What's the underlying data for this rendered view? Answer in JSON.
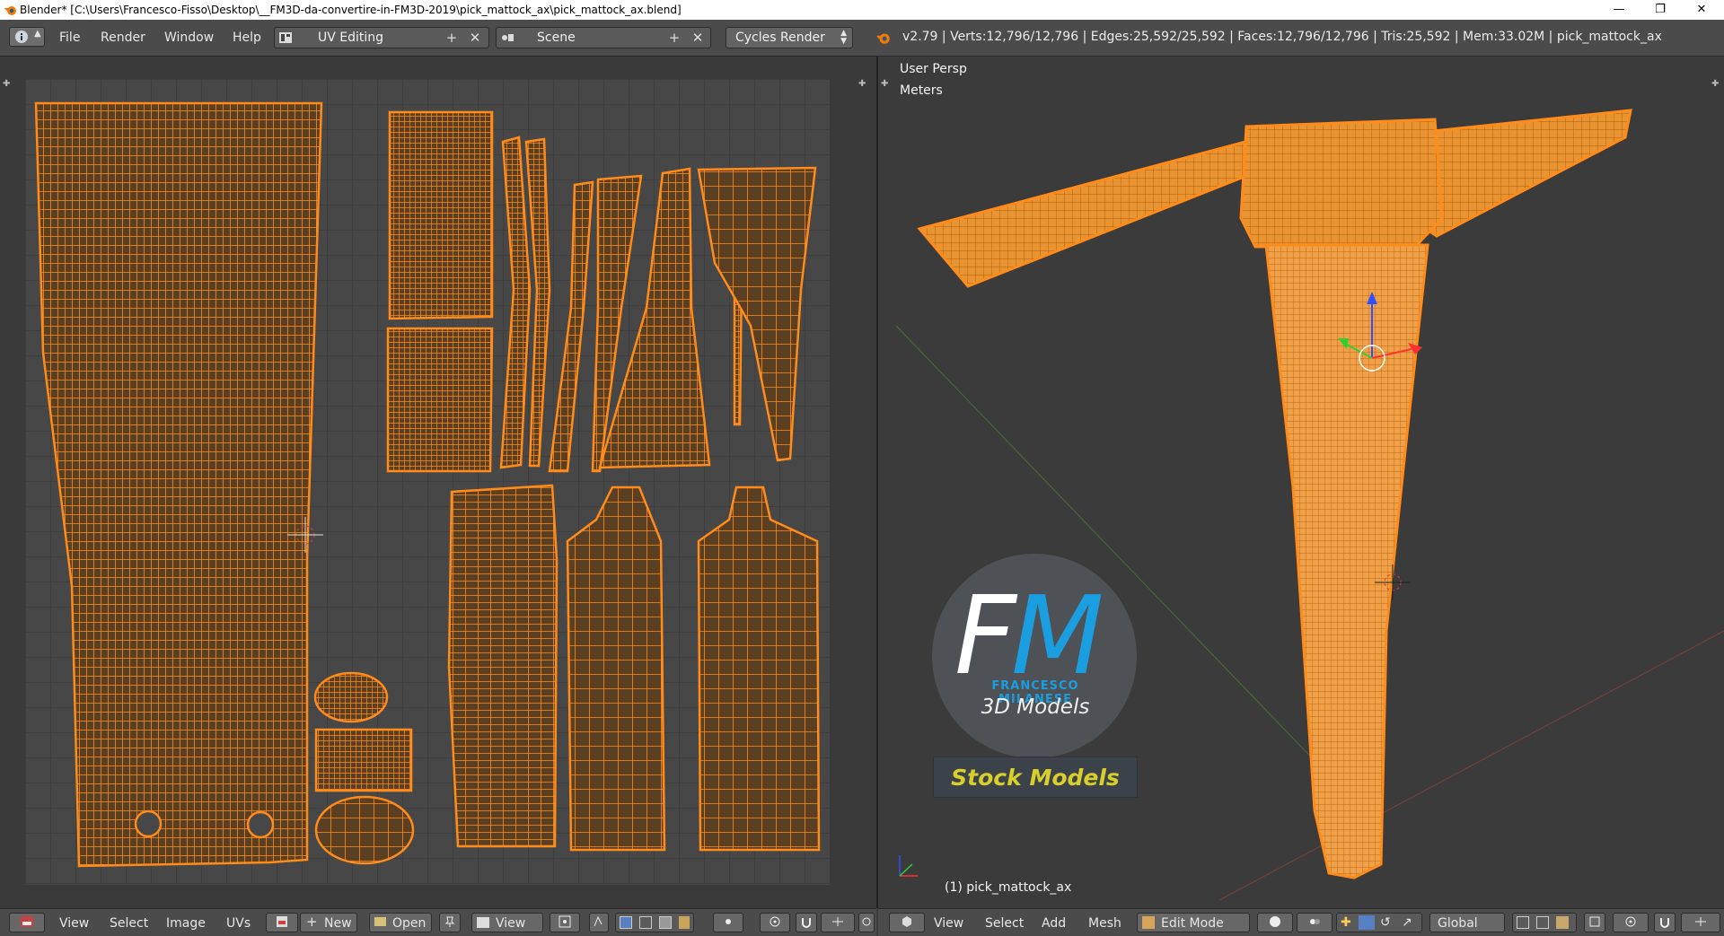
{
  "window": {
    "title": "Blender* [C:\\Users\\Francesco-Fisso\\Desktop\\__FM3D-da-convertire-in-FM3D-2019\\pick_mattock_ax\\pick_mattock_ax.blend]",
    "minimize": "—",
    "maximize": "❐",
    "close": "✕"
  },
  "header": {
    "menus": [
      "File",
      "Render",
      "Window",
      "Help"
    ],
    "screen_layout": "UV Editing",
    "scene": "Scene",
    "render_engine": "Cycles Render",
    "stats": "v2.79 | Verts:12,796/12,796 | Edges:25,592/25,592 | Faces:12,796/12,796 | Tris:25,592 | Mem:33.02M | pick_mattock_ax"
  },
  "viewport": {
    "view_name": "User Persp",
    "units": "Meters",
    "object_label": "(1) pick_mattock_ax",
    "accent": "#ff8c1a"
  },
  "watermark": {
    "fm_f": "F",
    "fm_m": "M",
    "name": "FRANCESCO MILANESE",
    "subtitle": "3D Models",
    "stock": "Stock Models"
  },
  "uv_footer": {
    "menus": [
      "View",
      "Select",
      "Image",
      "UVs"
    ],
    "new_label": "New",
    "open_label": "Open",
    "view_label": "View"
  },
  "vp_footer": {
    "menus": [
      "View",
      "Select",
      "Add",
      "Mesh"
    ],
    "mode": "Edit Mode",
    "orientation": "Global"
  }
}
